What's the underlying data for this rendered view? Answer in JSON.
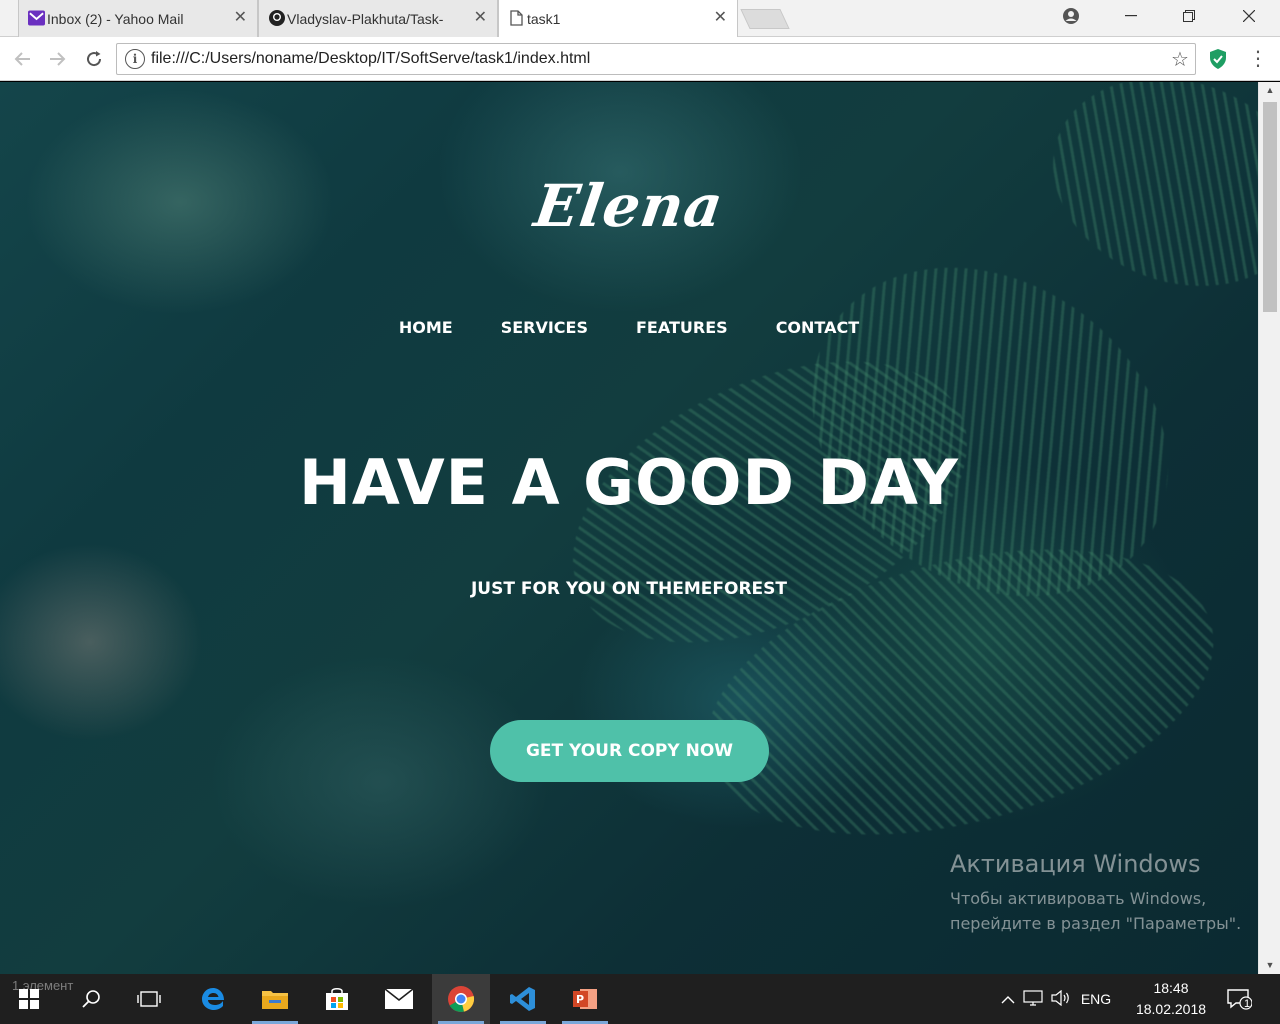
{
  "browser": {
    "tabs": [
      {
        "title": "Inbox (2) - Yahoo Mail",
        "icon": "yahoo-mail-icon",
        "active": false
      },
      {
        "title": "Vladyslav-Plakhuta/Task-",
        "icon": "github-icon",
        "active": false
      },
      {
        "title": "task1",
        "icon": "document-icon",
        "active": true
      }
    ],
    "close_glyph": "✕",
    "url": "file:///C:/Users/noname/Desktop/IT/SoftServe/task1/index.html",
    "colors": {
      "shield": "#1e9e63"
    }
  },
  "page": {
    "logo": "Elena",
    "nav": [
      {
        "label": "HOME"
      },
      {
        "label": "SERVICES"
      },
      {
        "label": "FEATURES"
      },
      {
        "label": "CONTACT"
      }
    ],
    "hero_title": "HAVE A GOOD DAY",
    "hero_subtitle": "JUST FOR YOU ON THEMEFOREST",
    "cta_label": "GET YOUR COPY NOW",
    "colors": {
      "cta": "#4fc1a9",
      "text": "#ffffff"
    }
  },
  "windows_activation": {
    "title": "Активация Windows",
    "line1": "Чтобы активировать Windows,",
    "line2": "перейдите в раздел \"Параметры\"."
  },
  "taskbar": {
    "status": "1 элемент",
    "language": "ENG",
    "time": "18:48",
    "date": "18.02.2018",
    "notification_count": "1",
    "apps": [
      "start-icon",
      "search-icon",
      "task-view-icon",
      "edge-icon",
      "file-explorer-icon",
      "store-icon",
      "mail-icon",
      "chrome-icon",
      "vscode-icon",
      "powerpoint-icon"
    ]
  }
}
